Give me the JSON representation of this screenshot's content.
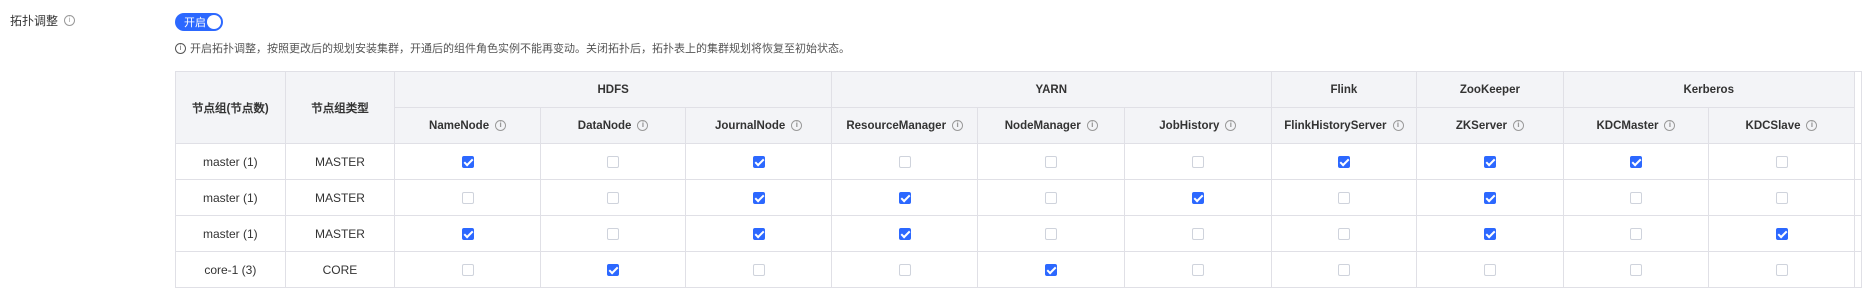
{
  "field": {
    "label": "拓扑调整"
  },
  "switch": {
    "text": "开启",
    "on": true
  },
  "hint": "开启拓扑调整，按照更改后的规划安装集群，开通后的组件角色实例不能再变动。关闭拓扑后，拓扑表上的集群规划将恢复至初始状态。",
  "table": {
    "col_group_name": "节点组(节点数)",
    "col_group_type": "节点组类型",
    "services": [
      {
        "name": "HDFS",
        "span": 3
      },
      {
        "name": "YARN",
        "span": 3
      },
      {
        "name": "Flink",
        "span": 1
      },
      {
        "name": "ZooKeeper",
        "span": 1
      },
      {
        "name": "Kerberos",
        "span": 2
      }
    ],
    "roles": [
      "NameNode",
      "DataNode",
      "JournalNode",
      "ResourceManager",
      "NodeManager",
      "JobHistory",
      "FlinkHistoryServer",
      "ZKServer",
      "KDCMaster",
      "KDCSlave"
    ],
    "rows": [
      {
        "group": "master (1)",
        "type": "MASTER",
        "checks": [
          true,
          false,
          true,
          false,
          false,
          false,
          true,
          true,
          true,
          false
        ]
      },
      {
        "group": "master (1)",
        "type": "MASTER",
        "checks": [
          false,
          false,
          true,
          true,
          false,
          true,
          false,
          true,
          false,
          false
        ]
      },
      {
        "group": "master (1)",
        "type": "MASTER",
        "checks": [
          true,
          false,
          true,
          true,
          false,
          false,
          false,
          true,
          false,
          true
        ]
      },
      {
        "group": "core-1 (3)",
        "type": "CORE",
        "checks": [
          false,
          true,
          false,
          false,
          true,
          false,
          false,
          false,
          false,
          false
        ]
      }
    ]
  },
  "colors": {
    "accent": "#2c68ff",
    "header_bg": "#f3f4f7",
    "border": "#e0e0e6"
  }
}
